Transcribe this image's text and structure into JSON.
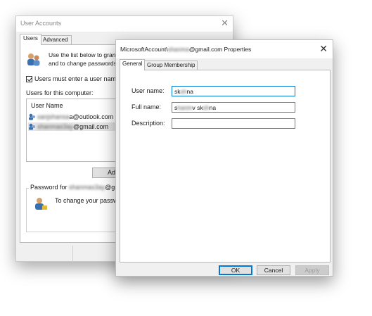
{
  "user_accounts": {
    "title": "User Accounts",
    "close_glyph": "✕",
    "tabs": [
      "Users",
      "Advanced"
    ],
    "intro_line1": "Use the list below to grant",
    "intro_line2": "and to change passwords a",
    "must_enter_label": "Users must enter a user name and",
    "must_enter_checked": true,
    "users_label": "Users for this computer:",
    "list_header": "User Name",
    "users": [
      {
        "prefix": "sanjshansa",
        "suffix": "a@outlook.com"
      },
      {
        "prefix": "shanmas3ay",
        "suffix": "@gmail.com"
      }
    ],
    "add_label": "Add",
    "password_group_prefix": "Password for",
    "password_group_hidden": "shanmas3ay",
    "password_group_suffix": "@gmail.c",
    "password_text": "To change your passwor"
  },
  "properties": {
    "title_prefix": "MicrosoftAccount\\",
    "title_hidden": "shanma",
    "title_suffix": "@gmail.com Properties",
    "close_glyph": "✕",
    "tabs": [
      "General",
      "Group Membership"
    ],
    "fields": {
      "username_label": "User name:",
      "username_a": "sk",
      "username_hidden": "sh",
      "username_b": "na",
      "fullname_label": "Full name:",
      "fullname_a": "s",
      "fullname_hidden1": "hanm",
      "fullname_b": "v sk",
      "fullname_hidden2": "sh",
      "fullname_c": "na",
      "description_label": "Description:",
      "description_value": ""
    },
    "buttons": {
      "ok": "OK",
      "cancel": "Cancel",
      "apply": "Apply"
    }
  },
  "colors": {
    "focus_border": "#0078d7",
    "window_bg": "#f0f0f0"
  }
}
